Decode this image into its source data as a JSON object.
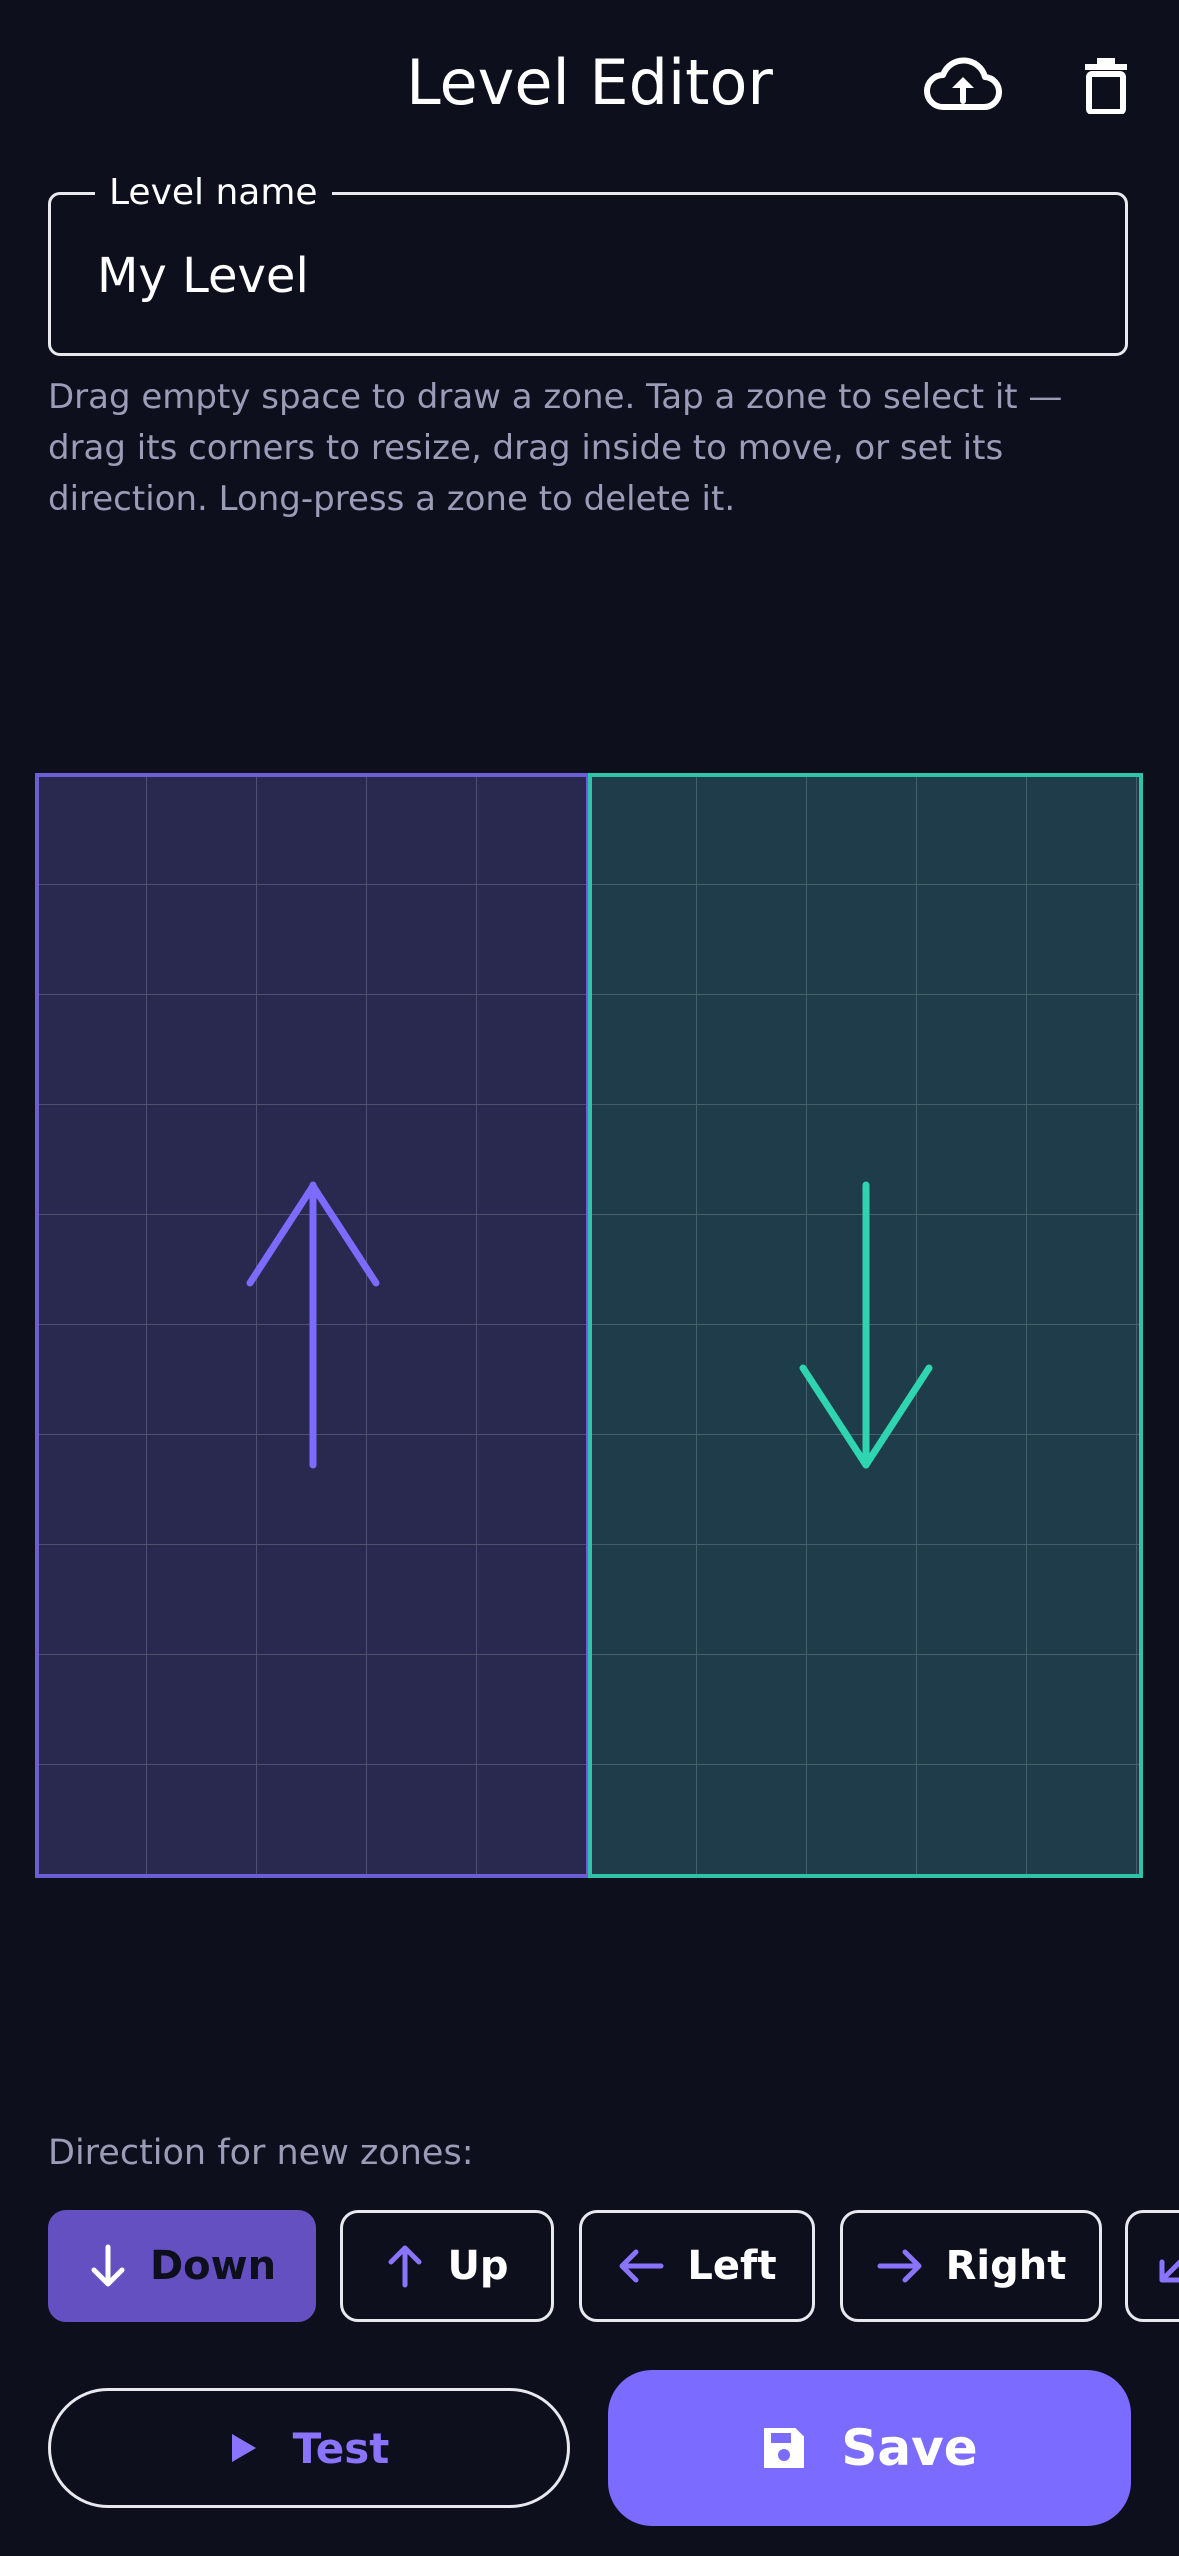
{
  "header": {
    "title": "Level Editor",
    "icons": {
      "upload": "cloud-upload-icon",
      "delete": "trash-icon"
    }
  },
  "name_field": {
    "label": "Level name",
    "value": "My Level"
  },
  "hint": "Drag empty space to draw a zone. Tap a zone to select it — drag its corners to resize, drag inside to move, or set its direction. Long-press a zone to delete it.",
  "zones": [
    {
      "direction": "up",
      "color": "#6c5fd6",
      "icon": "arrow-up-icon"
    },
    {
      "direction": "down",
      "color": "#2fd4b0",
      "icon": "arrow-down-icon"
    }
  ],
  "direction_picker": {
    "label": "Direction for new zones:",
    "options": [
      {
        "label": "Down",
        "icon": "arrow-down-icon",
        "selected": true
      },
      {
        "label": "Up",
        "icon": "arrow-up-icon",
        "selected": false
      },
      {
        "label": "Left",
        "icon": "arrow-left-icon",
        "selected": false
      },
      {
        "label": "Right",
        "icon": "arrow-right-icon",
        "selected": false
      },
      {
        "label": "",
        "icon": "arrow-down-left-icon",
        "selected": false
      }
    ]
  },
  "actions": {
    "test_label": "Test",
    "save_label": "Save"
  },
  "colors": {
    "background": "#0e0f1c",
    "accent": "#7b6cff",
    "selected_chip": "#6450c0",
    "zone_up": "#6c5fd6",
    "zone_down": "#2fd4b0",
    "muted_text": "#9a9cb8"
  }
}
